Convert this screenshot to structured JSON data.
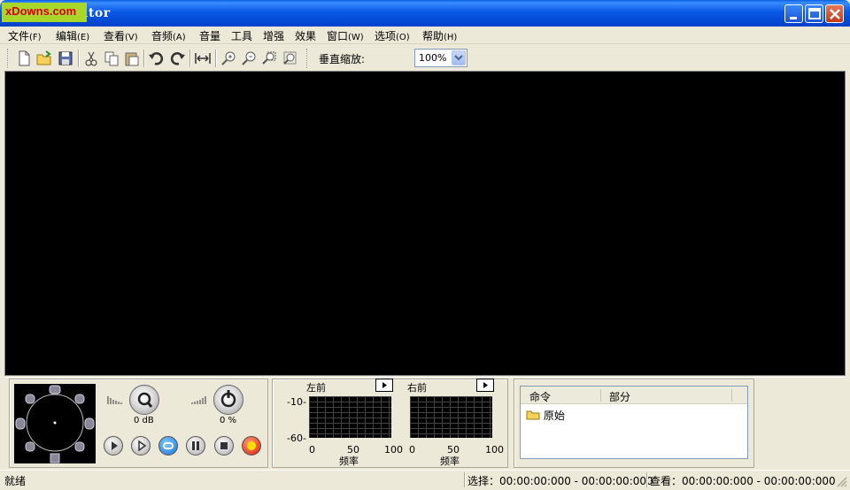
{
  "window": {
    "title": "WaveEditor",
    "watermark": "xDowns.com"
  },
  "menu": [
    {
      "label": "文件",
      "accel": "(F)"
    },
    {
      "label": "编辑",
      "accel": "(E)"
    },
    {
      "label": "查看",
      "accel": "(V)"
    },
    {
      "label": "音频",
      "accel": "(A)"
    },
    {
      "label": "音量",
      "accel": ""
    },
    {
      "label": "工具",
      "accel": ""
    },
    {
      "label": "增强",
      "accel": ""
    },
    {
      "label": "效果",
      "accel": ""
    },
    {
      "label": "窗口",
      "accel": "(W)"
    },
    {
      "label": "选项",
      "accel": "(O)"
    },
    {
      "label": "帮助",
      "accel": "(H)"
    }
  ],
  "toolbar": {
    "zoom_label": "垂直缩放:",
    "zoom_value": "100%",
    "icons": [
      "new-file-icon",
      "open-folder-icon",
      "save-icon",
      "cut-icon",
      "copy-icon",
      "paste-icon",
      "undo-icon",
      "redo-icon",
      "fit-width-icon",
      "zoom-in-icon",
      "zoom-out-icon",
      "zoom-selection-icon",
      "zoom-full-icon"
    ]
  },
  "mixer": {
    "volume_value": "0 dB",
    "balance_value": "0 %"
  },
  "spectrum": {
    "left_label": "左前",
    "right_label": "右前",
    "y_ticks": [
      "-10-",
      "-60-"
    ],
    "x_ticks": [
      "0",
      "50",
      "100"
    ],
    "x_label": "频率"
  },
  "commands": {
    "col_command": "命令",
    "col_part": "部分",
    "rows": [
      "原始"
    ]
  },
  "status": {
    "ready": "就绪",
    "selection": "选择：00:00:00:000 - 00:00:00:000",
    "view": "查看：00:00:00:000 - 00:00:00:000"
  }
}
